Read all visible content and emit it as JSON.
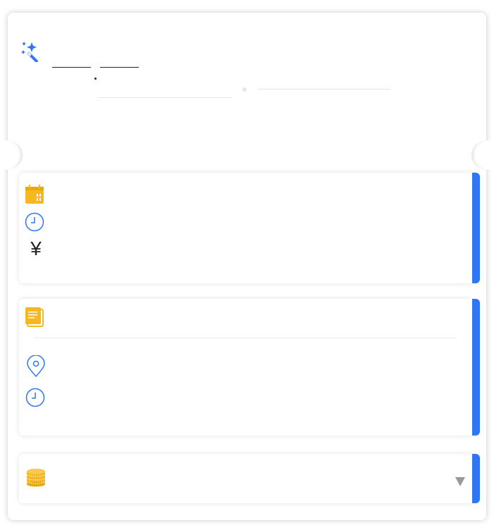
{
  "header": {
    "icon": "magic-wand-icon",
    "title_part_1": "",
    "title_part_2": "",
    "subtitle_left": "",
    "subtitle_right": ""
  },
  "schedule_card": {
    "icons": [
      "calendar-icon",
      "clock-icon",
      "yen-icon"
    ],
    "yen_symbol": "¥",
    "date_value": "",
    "time_value": "",
    "price_value": ""
  },
  "detail_card": {
    "icons": [
      "notes-icon",
      "location-pin-icon",
      "clock-icon"
    ],
    "notes_value": "",
    "location_value": "",
    "time_value": ""
  },
  "coin_card": {
    "icon": "coin-stack-icon",
    "value": "",
    "dropdown_icon": "triangle-down-icon"
  },
  "colors": {
    "accent_blue": "#2f76f6",
    "icon_yellow": "#f5b820",
    "text_dark": "#222222"
  }
}
